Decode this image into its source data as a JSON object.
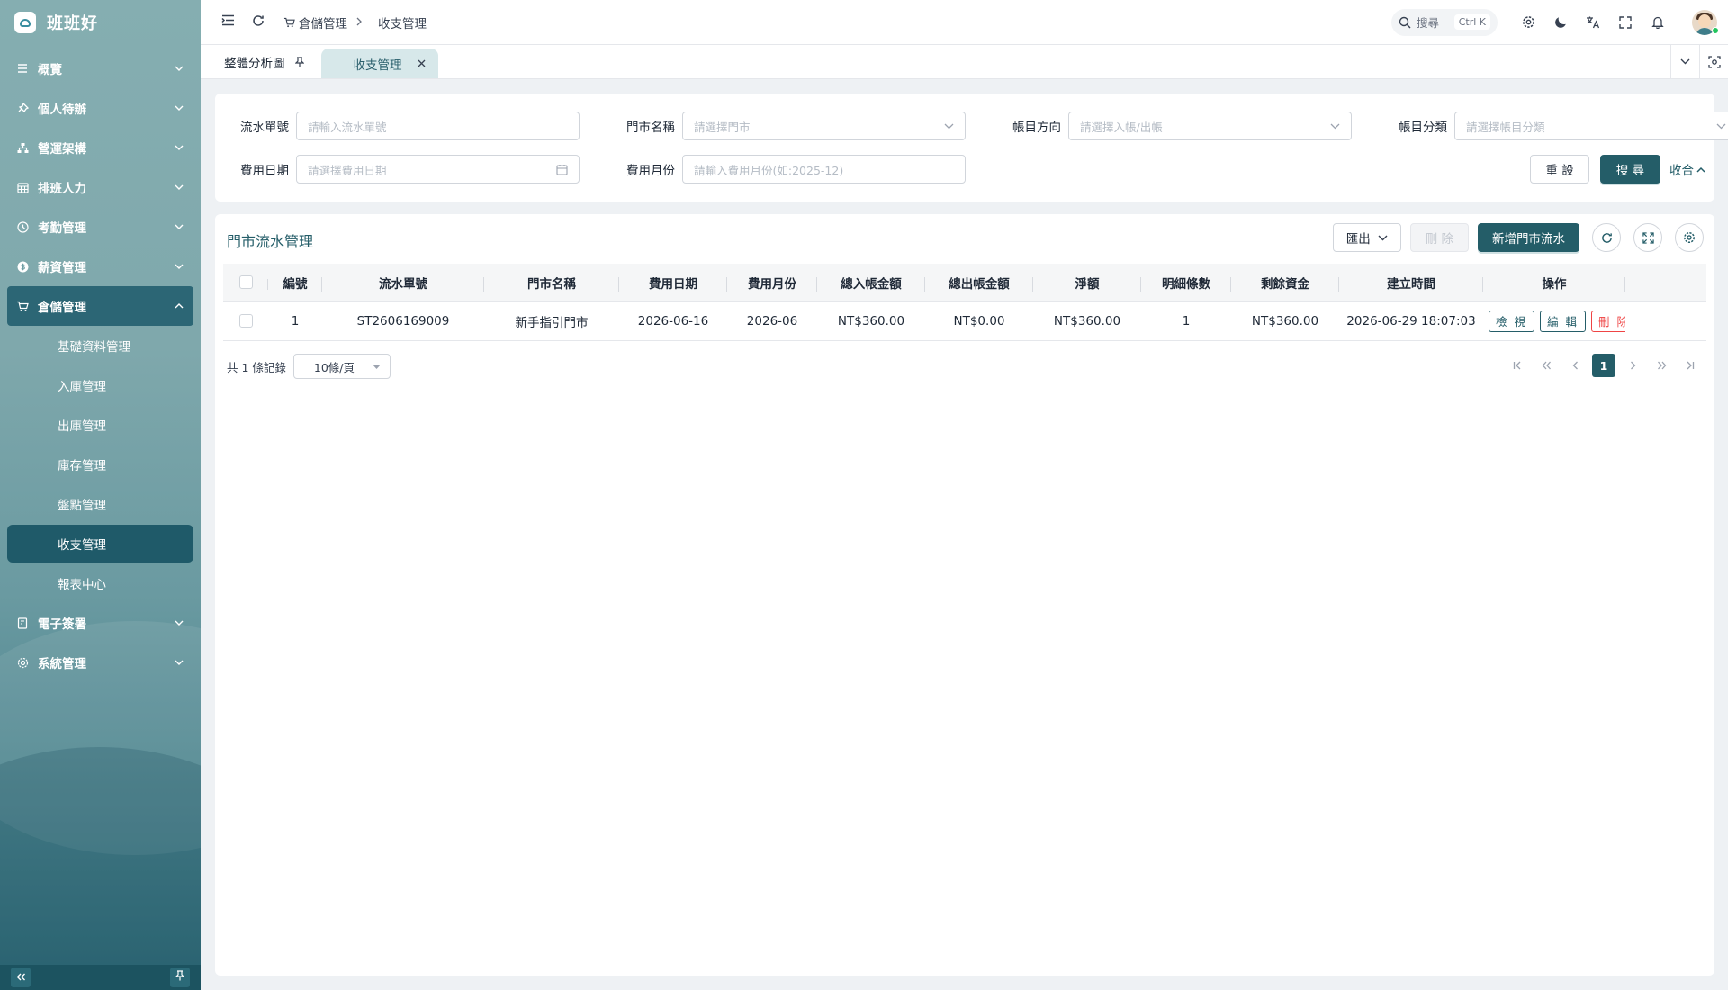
{
  "brand": {
    "name": "班班好"
  },
  "colors": {
    "accent": "#245d68",
    "sidebar_active": "#1f5a69",
    "danger": "#ef4444",
    "online": "#22c55e"
  },
  "sidebar": {
    "items": [
      {
        "label": "概覽",
        "icon": "menu-lines-icon"
      },
      {
        "label": "個人待辦",
        "icon": "pin-icon"
      },
      {
        "label": "營運架構",
        "icon": "org-chart-icon"
      },
      {
        "label": "排班人力",
        "icon": "calendar-grid-icon"
      },
      {
        "label": "考勤管理",
        "icon": "clock-icon"
      },
      {
        "label": "薪資管理",
        "icon": "dollar-coin-icon"
      },
      {
        "label": "倉儲管理",
        "icon": "cart-icon"
      },
      {
        "label": "電子簽署",
        "icon": "document-icon"
      },
      {
        "label": "系統管理",
        "icon": "gear-icon"
      }
    ],
    "open_submenu": [
      {
        "label": "基礎資料管理"
      },
      {
        "label": "入庫管理"
      },
      {
        "label": "出庫管理"
      },
      {
        "label": "庫存管理"
      },
      {
        "label": "盤點管理"
      },
      {
        "label": "收支管理"
      },
      {
        "label": "報表中心"
      }
    ]
  },
  "header": {
    "breadcrumb": [
      "倉儲管理",
      "收支管理"
    ],
    "search": {
      "label": "搜尋",
      "shortcut": "Ctrl K"
    }
  },
  "tabs": [
    {
      "label": "整體分析圖",
      "icon": "pin-icon"
    },
    {
      "label": "收支管理",
      "icon": "close-icon"
    }
  ],
  "filters": {
    "serial_no": {
      "label": "流水單號",
      "placeholder": "請輸入流水單號"
    },
    "store_name": {
      "label": "門市名稱",
      "placeholder": "請選擇門市"
    },
    "direction": {
      "label": "帳目方向",
      "placeholder": "請選擇入帳/出帳"
    },
    "category": {
      "label": "帳目分類",
      "placeholder": "請選擇帳目分類"
    },
    "expense_date": {
      "label": "費用日期",
      "placeholder": "請選擇費用日期"
    },
    "expense_month": {
      "label": "費用月份",
      "placeholder": "請輸入費用月份(如:2025-12)"
    },
    "reset_label": "重 設",
    "search_label": "搜 尋",
    "collapse_label": "收合"
  },
  "panel": {
    "title": "門市流水管理",
    "export_label": "匯出",
    "delete_label": "刪 除",
    "add_label": "新增門市流水"
  },
  "table": {
    "columns": [
      "編號",
      "流水單號",
      "門市名稱",
      "費用日期",
      "費用月份",
      "總入帳金額",
      "總出帳金額",
      "淨額",
      "明細條數",
      "剩餘資金",
      "建立時間",
      "操作"
    ],
    "rows": [
      {
        "no": "1",
        "serial": "ST2606169009",
        "store": "新手指引門市",
        "date": "2026-06-16",
        "month": "2026-06",
        "income": "NT$360.00",
        "expense": "NT$0.00",
        "net": "NT$360.00",
        "detail_count": "1",
        "balance": "NT$360.00",
        "created": "2026-06-29 18:07:03",
        "actions": [
          "檢 視",
          "編 輯",
          "刪 除"
        ]
      }
    ]
  },
  "pagination": {
    "total_text": "共 1 條記錄",
    "page_size": "10條/頁",
    "current_page": "1"
  }
}
